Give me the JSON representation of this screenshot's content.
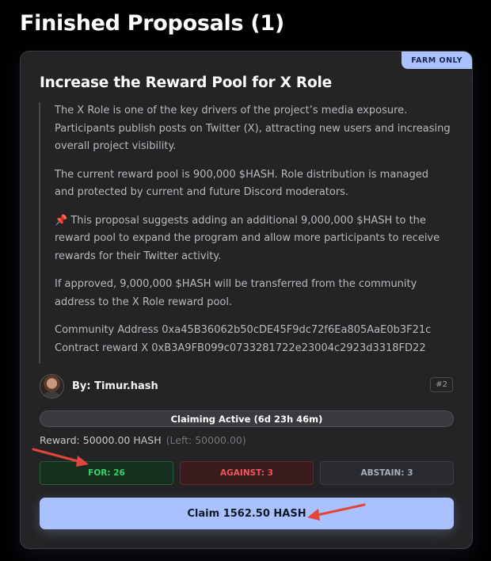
{
  "page": {
    "title": "Finished Proposals (1)"
  },
  "card": {
    "badge": "FARM ONLY",
    "title": "Increase the Reward Pool for X Role",
    "description": {
      "p1": "The X Role is one of the key drivers of the project’s media exposure. Participants publish posts on Twitter (X), attracting new users and increasing overall project visibility.",
      "p2": "The current reward pool is 900,000 $HASH. Role distribution is managed and protected by current and future Discord moderators.",
      "p3": "This proposal suggests adding an additional 9,000,000 $HASH to the reward pool to expand the program and allow more participants to receive rewards for their Twitter activity.",
      "p4": "If approved, 9,000,000 $HASH will be transferred from the community address to the X Role reward pool.",
      "community_address": "Community Address 0xa45B36062b50cDE45F9dc72f6Ea805AaE0b3F21c",
      "contract_reward": "Contract reward X 0xB3A9FB099c0733281722e23004c2923d3318FD22"
    },
    "author": {
      "label": "By: Timur.hash"
    },
    "proposal_id": "#2",
    "status": "Claiming Active (6d 23h 46m)",
    "reward": {
      "text": "Reward: 50000.00 HASH",
      "left": "(Left: 50000.00)"
    },
    "votes": {
      "for": "FOR: 26",
      "against": "AGAINST: 3",
      "abstain": "ABSTAIN: 3"
    },
    "claim_button": "Claim 1562.50 HASH"
  },
  "icons": {
    "pin": "pushpin-icon",
    "annotation_arrows": "red-arrow-icon"
  },
  "colors": {
    "accent": "#a9c1ff",
    "for": "#35d36b",
    "against": "#f0555b",
    "abstain": "#a9acb8",
    "arrow": "#e2453c"
  }
}
